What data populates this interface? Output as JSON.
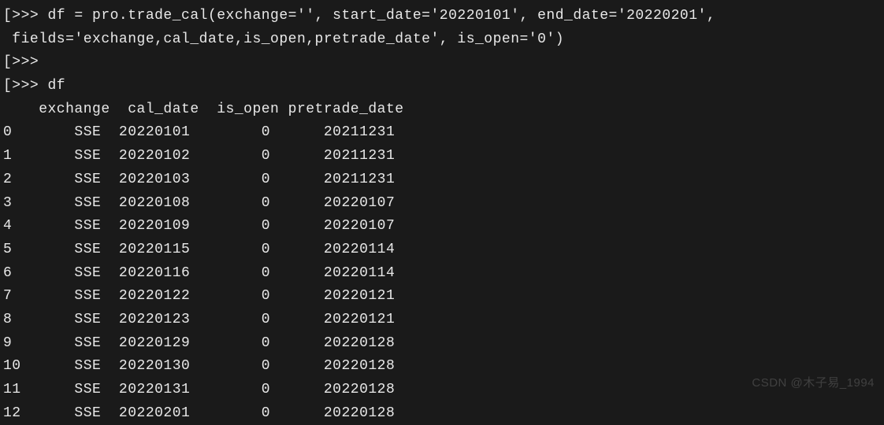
{
  "prompt1_a": "[>>> df = pro.trade_cal(exchange='', start_date='20220101', end_date='20220201',",
  "prompt1_b": " fields='exchange,cal_date,is_open,pretrade_date', is_open='0')",
  "prompt2": "[>>>",
  "prompt3": "[>>> df",
  "header": "    exchange  cal_date  is_open pretrade_date",
  "rows": [
    "0       SSE  20220101        0      20211231",
    "1       SSE  20220102        0      20211231",
    "2       SSE  20220103        0      20211231",
    "3       SSE  20220108        0      20220107",
    "4       SSE  20220109        0      20220107",
    "5       SSE  20220115        0      20220114",
    "6       SSE  20220116        0      20220114",
    "7       SSE  20220122        0      20220121",
    "8       SSE  20220123        0      20220121",
    "9       SSE  20220129        0      20220128",
    "10      SSE  20220130        0      20220128",
    "11      SSE  20220131        0      20220128",
    "12      SSE  20220201        0      20220128"
  ],
  "watermark": "CSDN @木子易_1994"
}
